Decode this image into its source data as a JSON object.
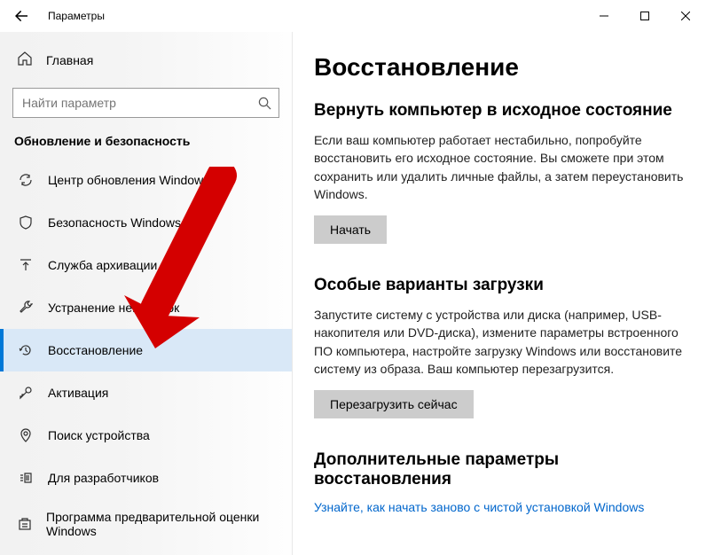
{
  "titlebar": {
    "title": "Параметры"
  },
  "sidebar": {
    "home": "Главная",
    "search_placeholder": "Найти параметр",
    "category": "Обновление и безопасность",
    "items": [
      {
        "label": "Центр обновления Windows"
      },
      {
        "label": "Безопасность Windows"
      },
      {
        "label": "Служба архивации"
      },
      {
        "label": "Устранение неполадок"
      },
      {
        "label": "Восстановление"
      },
      {
        "label": "Активация"
      },
      {
        "label": "Поиск устройства"
      },
      {
        "label": "Для разработчиков"
      },
      {
        "label": "Программа предварительной оценки Windows"
      }
    ]
  },
  "main": {
    "title": "Восстановление",
    "reset": {
      "heading": "Вернуть компьютер в исходное состояние",
      "desc": "Если ваш компьютер работает нестабильно, попробуйте восстановить его исходное состояние. Вы сможете при этом сохранить или удалить личные файлы, а затем переустановить Windows.",
      "button": "Начать"
    },
    "advanced": {
      "heading": "Особые варианты загрузки",
      "desc": "Запустите систему с устройства или диска (например, USB-накопителя или DVD-диска), измените параметры встроенного ПО компьютера, настройте загрузку Windows или восстановите систему из образа. Ваш компьютер перезагрузится.",
      "button": "Перезагрузить сейчас"
    },
    "more": {
      "heading": "Дополнительные параметры восстановления",
      "link": "Узнайте, как начать заново с чистой установкой Windows"
    }
  }
}
